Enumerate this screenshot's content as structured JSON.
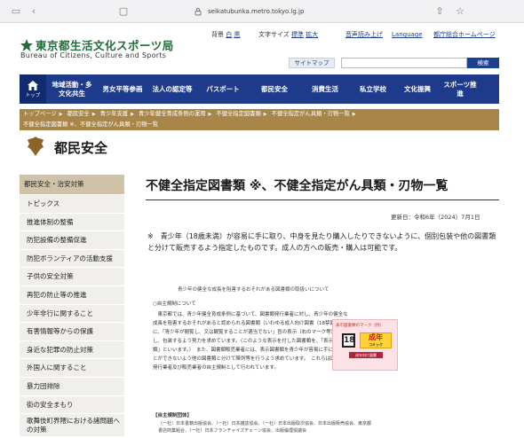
{
  "browser": {
    "url": "seikatubunka.metro.tokyo.lg.jp"
  },
  "header": {
    "logo_ja": "東京都生活文化スポーツ局",
    "logo_en": "Bureau of Citizens, Culture and Sports",
    "background_label": "背景",
    "bg_white": "白",
    "bg_black": "黒",
    "fontsize_label": "文字サイズ",
    "fontsize_std": "標準",
    "fontsize_large": "拡大",
    "read_aloud": "音声読み上げ",
    "language": "Language",
    "tokyo_home": "都庁総合ホームページ",
    "sitemap": "サイトマップ",
    "search_placeholder": "",
    "search_button": "検索"
  },
  "gnav": {
    "home": "トップ",
    "items": [
      "地域活動・多文化共生",
      "男女平等参画",
      "法人の認定等",
      "パスポート",
      "都民安全",
      "消費生活",
      "私立学校",
      "文化振興",
      "スポーツ推進"
    ]
  },
  "breadcrumbs": [
    "トップページ",
    "都民安全",
    "青少年支援",
    "青少年健全育成条例の運用",
    "不健全指定図書類",
    "不健全指定がん具類・刃物一覧",
    "不健全指定図書類 ※、不健全指定がん具類・刃物一覧"
  ],
  "category_title": "都民安全",
  "sidebar": {
    "heading": "都民安全・治安対策",
    "items": [
      "トピックス",
      "推進体制の整備",
      "防犯設備の整備促進",
      "防犯ボランティアの活動支援",
      "子供の安全対策",
      "再犯の防止等の推進",
      "少年非行に関すること",
      "有害情報等からの保護",
      "身近な犯罪の防止対策",
      "外国人に関すること",
      "暴力団排除",
      "街の安全まもり",
      "歌舞伎町界隈における諸問題への対策"
    ]
  },
  "main": {
    "title": "不健全指定図書類 ※、不健全指定がん具類・刃物一覧",
    "updated": "更新日：令和6年（2024）7月1日",
    "notice": "※　青少年（18歳未満）が容易に手に取り、中身を見たり購入したりできないように、個別包装や他の図書類と分けて販売するよう指定したものです。成人の方への販売・購入は可能です。"
  },
  "doc": {
    "heading": "青少年の健全な成長を阻害するおそれがある図書類の取扱いについて",
    "section": "○自主規制について",
    "body": "　東京都では、青少年健全育成条例に基づいて、図書類発行業者に対し、青少年の健全な成長を阻害するおそれがあると認められる図書類（いわゆる成人向け図書（18禁図書））に、「青少年が閲覧し、又は観覧することが適当でない」旨の表示（右のマーク等）をし、包装するよう努力を求めています。（このような表示を付した図書類を、「表示図書類」といいます。）　また、図書類販売業者には、表示図書類を青少年が容易に手に取ることができないよう他の図書類と分けて陳列等を行うよう求めています。　これらは図書類発行業者及び販売業者の自主規制として行われています。",
    "mark_label": "表示図書類のマーク（例）",
    "mark_18": "18",
    "mark_adult": "成年",
    "mark_adult_sub": "コミック",
    "mark_ribbon": "成年向け図書",
    "foot_head": "【自主規制団体】",
    "foot": "（一社）日本書籍出版協会、（一社）日本雑誌協会、（一社）日本出版取次協会、日本出版販売協会、東京都書店商業組合、（一社）日本フランチャイズチェーン協会、出版倫理協議会"
  }
}
